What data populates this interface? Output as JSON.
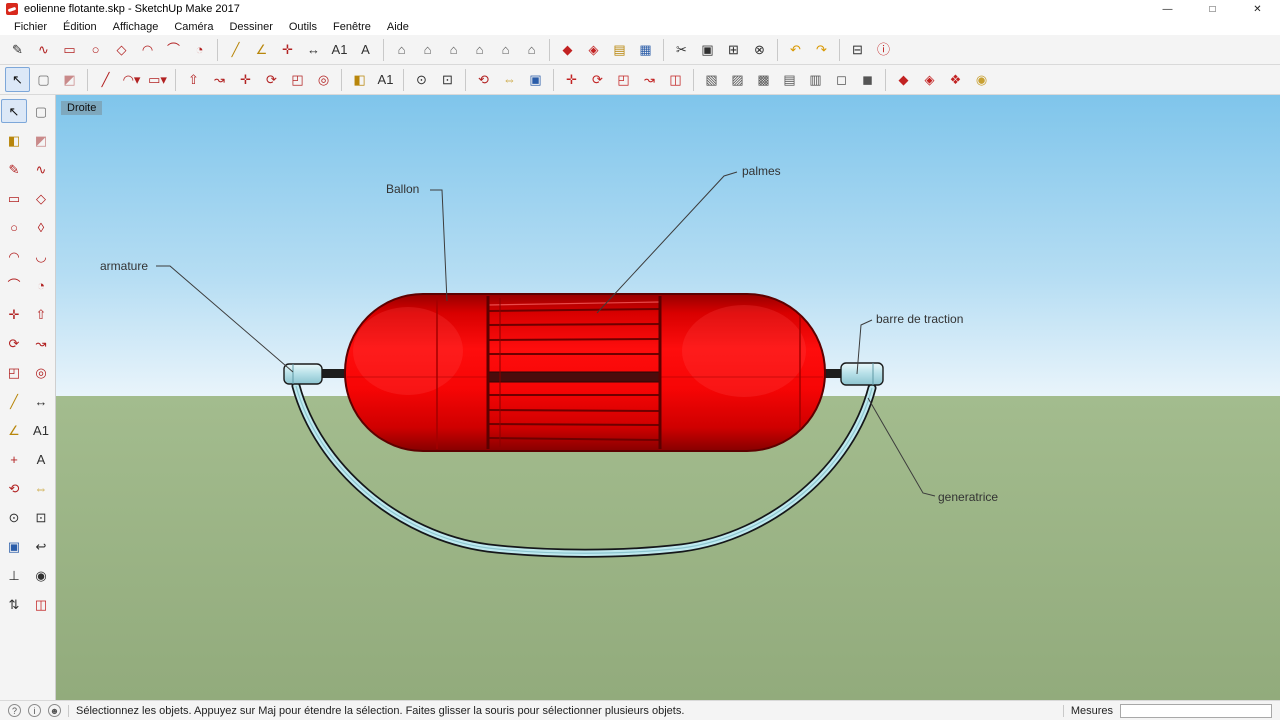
{
  "window": {
    "title": "eolienne flotante.skp - SketchUp Make 2017",
    "controls": {
      "minimize": "—",
      "maximize": "□",
      "close": "✕"
    }
  },
  "menu": {
    "items": [
      "Fichier",
      "Édition",
      "Affichage",
      "Caméra",
      "Dessiner",
      "Outils",
      "Fenêtre",
      "Aide"
    ]
  },
  "toolbars": {
    "row1": [
      {
        "name": "line-tool",
        "glyph": "✎",
        "color": "#303030"
      },
      {
        "name": "freehand-tool",
        "glyph": "∿",
        "color": "#b22222"
      },
      {
        "name": "rectangle-tool",
        "glyph": "▭",
        "color": "#b22222"
      },
      {
        "name": "circle-tool",
        "glyph": "○",
        "color": "#b22222"
      },
      {
        "name": "polygon-tool",
        "glyph": "◇",
        "color": "#b22222"
      },
      {
        "name": "arc-tool",
        "glyph": "◠",
        "color": "#b22222"
      },
      {
        "name": "two-point-arc-tool",
        "glyph": "⌒",
        "color": "#b22222"
      },
      {
        "name": "pie-tool",
        "glyph": "◔",
        "color": "#b22222"
      },
      {
        "sep": true
      },
      {
        "name": "tape-measure-tool",
        "glyph": "╱",
        "color": "#b8860b"
      },
      {
        "name": "protractor-tool",
        "glyph": "∠",
        "color": "#b8860b"
      },
      {
        "name": "axes-tool",
        "glyph": "✛",
        "color": "#b22222"
      },
      {
        "name": "dimension-tool",
        "glyph": "↔",
        "color": "#303030"
      },
      {
        "name": "text-tool",
        "glyph": "A1",
        "color": "#303030"
      },
      {
        "name": "3d-text-tool",
        "glyph": "A",
        "color": "#303030"
      },
      {
        "sep": true
      },
      {
        "name": "iso-view",
        "glyph": "⌂",
        "color": "#5a5a5a"
      },
      {
        "name": "top-view",
        "glyph": "⌂",
        "color": "#5a5a5a"
      },
      {
        "name": "front-view",
        "glyph": "⌂",
        "color": "#5a5a5a"
      },
      {
        "name": "right-view",
        "glyph": "⌂",
        "color": "#5a5a5a"
      },
      {
        "name": "back-view",
        "glyph": "⌂",
        "color": "#5a5a5a"
      },
      {
        "name": "left-view",
        "glyph": "⌂",
        "color": "#5a5a5a"
      },
      {
        "sep": true
      },
      {
        "name": "3d-warehouse",
        "glyph": "◆",
        "color": "#c22222"
      },
      {
        "name": "share-model",
        "glyph": "◈",
        "color": "#c22222"
      },
      {
        "name": "open-file",
        "glyph": "▤",
        "color": "#b8860b"
      },
      {
        "name": "save-file",
        "glyph": "▦",
        "color": "#2a5ca8"
      },
      {
        "sep": true
      },
      {
        "name": "cut",
        "glyph": "✂",
        "color": "#303030"
      },
      {
        "name": "copy",
        "glyph": "▣",
        "color": "#303030"
      },
      {
        "name": "paste",
        "glyph": "⊞",
        "color": "#303030"
      },
      {
        "name": "erase",
        "glyph": "⊗",
        "color": "#303030"
      },
      {
        "sep": true
      },
      {
        "name": "undo",
        "glyph": "↶",
        "color": "#d99800"
      },
      {
        "name": "redo",
        "glyph": "↷",
        "color": "#d99800"
      },
      {
        "sep": true
      },
      {
        "name": "print",
        "glyph": "⊟",
        "color": "#303030"
      },
      {
        "name": "model-info",
        "glyph": "ⓘ",
        "color": "#c22222"
      }
    ],
    "row2": [
      {
        "name": "select-tool",
        "glyph": "↖",
        "color": "#111111",
        "active": true
      },
      {
        "name": "make-component",
        "glyph": "▢",
        "color": "#6f6f6f"
      },
      {
        "name": "eraser-tool",
        "glyph": "◩",
        "color": "#c98a8a"
      },
      {
        "sep": true
      },
      {
        "name": "line-tool-alt",
        "glyph": "╱",
        "color": "#b22222"
      },
      {
        "name": "arc-tools",
        "glyph": "◠▾",
        "color": "#b22222"
      },
      {
        "name": "shape-tools",
        "glyph": "▭▾",
        "color": "#b22222"
      },
      {
        "sep": true
      },
      {
        "name": "push-pull-tool",
        "glyph": "⇧",
        "color": "#b22222"
      },
      {
        "name": "follow-me-tool",
        "glyph": "↝",
        "color": "#b22222"
      },
      {
        "name": "move-tool",
        "glyph": "✛",
        "color": "#b22222"
      },
      {
        "name": "rotate-tool",
        "glyph": "⟳",
        "color": "#b22222"
      },
      {
        "name": "scale-tool",
        "glyph": "◰",
        "color": "#b22222"
      },
      {
        "name": "offset-tool",
        "glyph": "◎",
        "color": "#b22222"
      },
      {
        "sep": true
      },
      {
        "name": "paint-bucket-tool",
        "glyph": "◧",
        "color": "#b8860b"
      },
      {
        "name": "text-annotation-tool",
        "glyph": "A1",
        "color": "#303030"
      },
      {
        "sep": true
      },
      {
        "name": "zoom-tool",
        "glyph": "⊙",
        "color": "#303030"
      },
      {
        "name": "zoom-window-tool",
        "glyph": "⊡",
        "color": "#303030"
      },
      {
        "sep": true
      },
      {
        "name": "orbit-tool",
        "glyph": "⟲",
        "color": "#b22222"
      },
      {
        "name": "pan-tool",
        "glyph": "⇔",
        "color": "#c8a032"
      },
      {
        "name": "zoom-extents-tool",
        "glyph": "▣",
        "color": "#2a5ca8"
      },
      {
        "sep": true
      },
      {
        "name": "move-copy-tool",
        "glyph": "✛",
        "color": "#c22222"
      },
      {
        "name": "rotate-copy-tool",
        "glyph": "⟳",
        "color": "#c22222"
      },
      {
        "name": "scale-copy-tool",
        "glyph": "◰",
        "color": "#c22222"
      },
      {
        "name": "follow-path-tool",
        "glyph": "↝",
        "color": "#c22222"
      },
      {
        "name": "section-plane-tool",
        "glyph": "◫",
        "color": "#c22222"
      },
      {
        "sep": true
      },
      {
        "name": "section-display-toggle",
        "glyph": "▧",
        "color": "#555555"
      },
      {
        "name": "section-cut-toggle",
        "glyph": "▨",
        "color": "#555555"
      },
      {
        "name": "section-fill-toggle",
        "glyph": "▩",
        "color": "#555555"
      },
      {
        "name": "back-edges-toggle",
        "glyph": "▤",
        "color": "#555555"
      },
      {
        "name": "xray-toggle",
        "glyph": "▥",
        "color": "#555555"
      },
      {
        "name": "wireframe-toggle",
        "glyph": "◻",
        "color": "#555555"
      },
      {
        "name": "shaded-toggle",
        "glyph": "◼",
        "color": "#555555"
      },
      {
        "sep": true
      },
      {
        "name": "warehouse-download",
        "glyph": "◆",
        "color": "#c22222"
      },
      {
        "name": "warehouse-share",
        "glyph": "◈",
        "color": "#c22222"
      },
      {
        "name": "extension-warehouse",
        "glyph": "❖",
        "color": "#c22222"
      },
      {
        "name": "instructor",
        "glyph": "◉",
        "color": "#c8a032"
      }
    ],
    "left": [
      {
        "name": "select-tool",
        "glyph": "↖",
        "color": "#111111",
        "active": true
      },
      {
        "name": "make-component",
        "glyph": "▢",
        "color": "#6f6f6f"
      },
      {
        "name": "paint-bucket-tool",
        "glyph": "◧",
        "color": "#b8860b"
      },
      {
        "name": "eraser-tool",
        "glyph": "◩",
        "color": "#c98a8a"
      },
      {
        "name": "line-tool",
        "glyph": "✎",
        "color": "#b22222"
      },
      {
        "name": "freehand-tool",
        "glyph": "∿",
        "color": "#b22222"
      },
      {
        "name": "rectangle-tool",
        "glyph": "▭",
        "color": "#b22222"
      },
      {
        "name": "rotated-rectangle-tool",
        "glyph": "◇",
        "color": "#b22222"
      },
      {
        "name": "circle-tool",
        "glyph": "○",
        "color": "#b22222"
      },
      {
        "name": "polygon-tool",
        "glyph": "◊",
        "color": "#b22222"
      },
      {
        "name": "arc-tool",
        "glyph": "◠",
        "color": "#b22222"
      },
      {
        "name": "two-point-arc-tool",
        "glyph": "◡",
        "color": "#b22222"
      },
      {
        "name": "three-point-arc-tool",
        "glyph": "⌒",
        "color": "#b22222"
      },
      {
        "name": "pie-tool",
        "glyph": "◔",
        "color": "#b22222"
      },
      {
        "name": "move-tool",
        "glyph": "✛",
        "color": "#b22222"
      },
      {
        "name": "push-pull-tool",
        "glyph": "⇧",
        "color": "#b22222"
      },
      {
        "name": "rotate-tool",
        "glyph": "⟳",
        "color": "#b22222"
      },
      {
        "name": "follow-me-tool",
        "glyph": "↝",
        "color": "#b22222"
      },
      {
        "name": "scale-tool",
        "glyph": "◰",
        "color": "#b22222"
      },
      {
        "name": "offset-tool",
        "glyph": "◎",
        "color": "#b22222"
      },
      {
        "name": "tape-measure-tool",
        "glyph": "╱",
        "color": "#b8860b"
      },
      {
        "name": "dimension-tool",
        "glyph": "↔",
        "color": "#303030"
      },
      {
        "name": "protractor-tool",
        "glyph": "∠",
        "color": "#b8860b"
      },
      {
        "name": "text-tool",
        "glyph": "A1",
        "color": "#303030"
      },
      {
        "name": "axes-tool",
        "glyph": "+",
        "color": "#b22222"
      },
      {
        "name": "3d-text-tool",
        "glyph": "A",
        "color": "#303030"
      },
      {
        "name": "orbit-tool",
        "glyph": "⟲",
        "color": "#b22222"
      },
      {
        "name": "pan-tool",
        "glyph": "⇔",
        "color": "#c8a032"
      },
      {
        "name": "zoom-tool",
        "glyph": "⊙",
        "color": "#303030"
      },
      {
        "name": "zoom-window-tool",
        "glyph": "⊡",
        "color": "#303030"
      },
      {
        "name": "zoom-extents-tool",
        "glyph": "▣",
        "color": "#2a5ca8"
      },
      {
        "name": "previous-view",
        "glyph": "↩",
        "color": "#303030"
      },
      {
        "name": "position-camera-tool",
        "glyph": "⊥",
        "color": "#303030"
      },
      {
        "name": "look-around-tool",
        "glyph": "◉",
        "color": "#303030"
      },
      {
        "name": "walk-tool",
        "glyph": "⇅",
        "color": "#303030"
      },
      {
        "name": "section-plane-tool",
        "glyph": "◫",
        "color": "#c22222"
      }
    ]
  },
  "viewport": {
    "view_label": "Droite",
    "annotations": [
      {
        "label": "Ballon"
      },
      {
        "label": "palmes"
      },
      {
        "label": "armature"
      },
      {
        "label": "barre de traction"
      },
      {
        "label": "generatrice"
      }
    ]
  },
  "statusbar": {
    "icons": [
      {
        "name": "help",
        "glyph": "?"
      },
      {
        "name": "info",
        "glyph": "i"
      },
      {
        "name": "user",
        "glyph": "☻"
      }
    ],
    "message": "Sélectionnez les objets. Appuyez sur Maj pour étendre la sélection. Faites glisser la souris pour sélectionner plusieurs objets.",
    "measures_label": "Mesures",
    "measures_value": ""
  },
  "colors": {
    "sky_top": "#7fc5eb",
    "sky_horizon": "#e9f4fb",
    "ground": "#9cb687",
    "balloon_red": "#f40404",
    "balloon_dark": "#8f0000",
    "tow_bar_cyan": "#bfe9ef",
    "toolbar_bg": "#f4f4f4",
    "accent_red": "#c22222"
  }
}
